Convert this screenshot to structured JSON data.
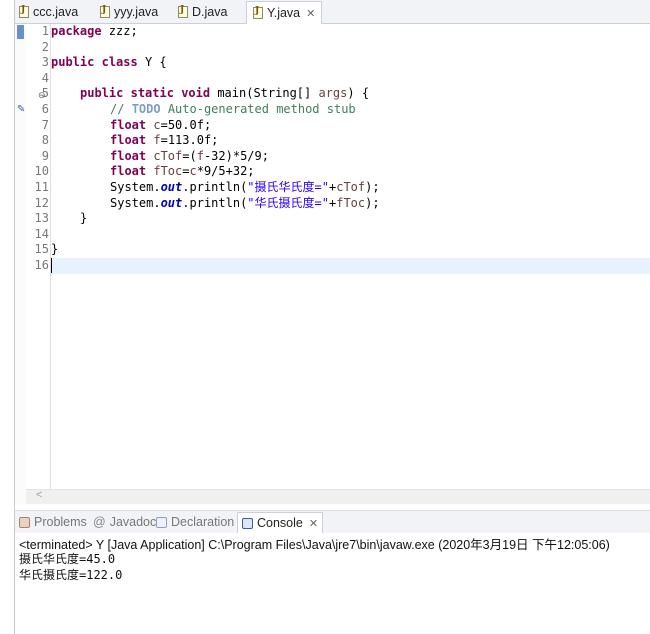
{
  "editor_tabs": [
    {
      "label": "ccc.java",
      "active": false
    },
    {
      "label": "yyy.java",
      "active": false
    },
    {
      "label": "D.java",
      "active": false
    },
    {
      "label": "Y.java",
      "active": true
    }
  ],
  "tab_close_glyph": "✕",
  "line_numbers": [
    "1",
    "2",
    "3",
    "4",
    "5",
    "6",
    "7",
    "8",
    "9",
    "10",
    "11",
    "12",
    "13",
    "14",
    "15",
    "16"
  ],
  "code": {
    "l1_kw": "package",
    "l1_rest": " zzz;",
    "l3_kw1": "public",
    "l3_kw2": "class",
    "l3_rest": " Y {",
    "l5_kw1": "public",
    "l5_kw2": "static",
    "l5_kw3": "void",
    "l5_rest1": " main(String[] ",
    "l5_var": "args",
    "l5_rest2": ") {",
    "l6_c1": "// ",
    "l6_todo": "TODO",
    "l6_c2": " Auto-generated method stub",
    "l7_kw": "float",
    "l7_var": "c",
    "l7_rest": "=50.0f;",
    "l8_kw": "float",
    "l8_var": "f",
    "l8_rest": "=113.0f;",
    "l9_kw": "float",
    "l9_var": "cTof",
    "l9_r1": "=(",
    "l9_var2": "f",
    "l9_r2": "-32)*5/9;",
    "l10_kw": "float",
    "l10_var": "fToc",
    "l10_r1": "=",
    "l10_var2": "c",
    "l10_r2": "*9/5+32;",
    "l11_a": "System.",
    "l11_fld": "out",
    "l11_b": ".println(",
    "l11_str": "\"摄氏华氏度=\"",
    "l11_c": "+",
    "l11_var": "cTof",
    "l11_d": ");",
    "l12_a": "System.",
    "l12_fld": "out",
    "l12_b": ".println(",
    "l12_str": "\"华氏摄氏度=\"",
    "l12_c": "+",
    "l12_var": "fToc",
    "l12_d": ");",
    "l13": "}",
    "l15": "}"
  },
  "bottom_tabs": {
    "problems": "Problems",
    "javadoc": "Javadoc",
    "declaration": "Declaration",
    "console": "Console"
  },
  "console": {
    "header": "<terminated> Y [Java Application] C:\\Program Files\\Java\\jre7\\bin\\javaw.exe (2020年3月19日 下午12:05:06)",
    "output": [
      "摄氏华氏度=45.0",
      "华氏摄氏度=122.0"
    ]
  },
  "colors": {
    "keyword": "#7f0055",
    "comment": "#3f7f5f",
    "string": "#2a00ff",
    "field": "#0000c0",
    "local_var": "#6a3e3e",
    "current_line": "#e8f2fe"
  }
}
